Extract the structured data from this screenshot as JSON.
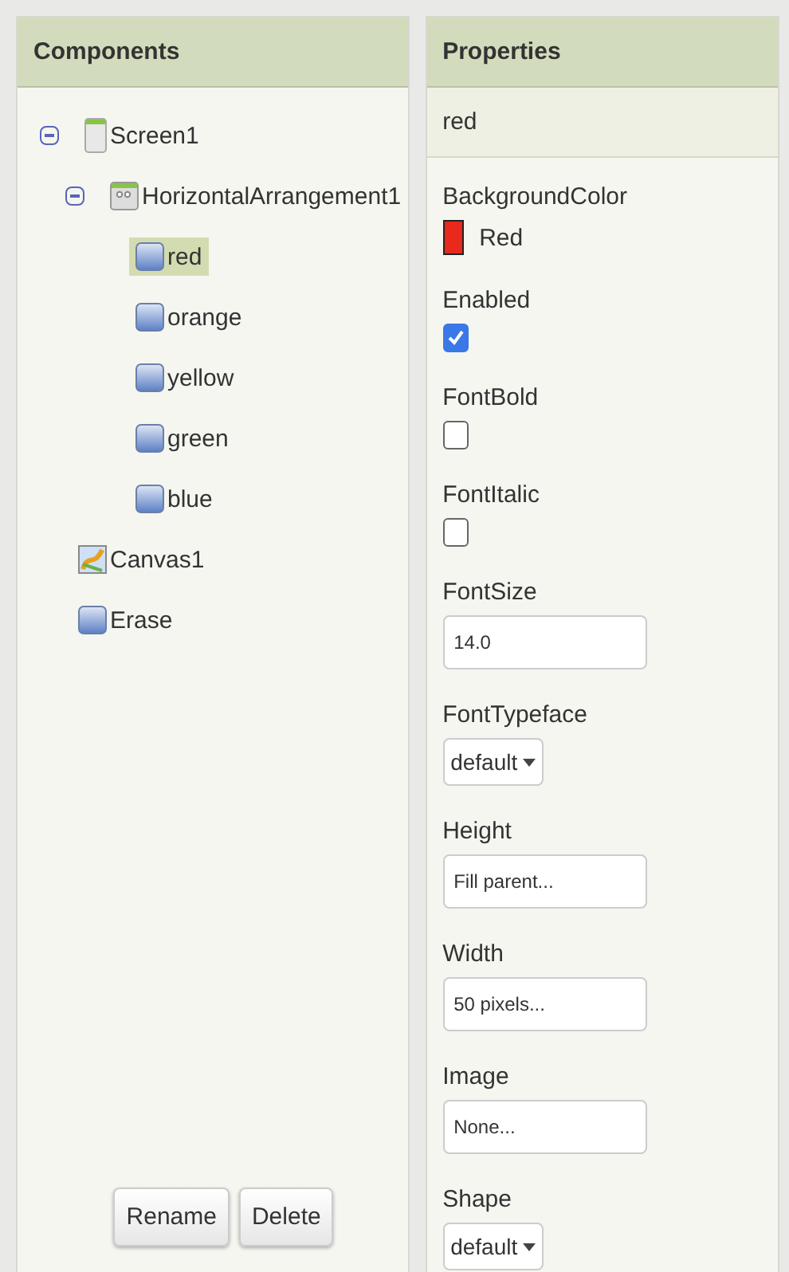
{
  "components": {
    "title": "Components",
    "tree": [
      {
        "label": "Screen1",
        "kind": "screen",
        "expanded": true,
        "selected": false,
        "children": [
          {
            "label": "HorizontalArrangement1",
            "kind": "arrangement",
            "expanded": true,
            "selected": false,
            "children": [
              {
                "label": "red",
                "kind": "button",
                "selected": true
              },
              {
                "label": "orange",
                "kind": "button",
                "selected": false
              },
              {
                "label": "yellow",
                "kind": "button",
                "selected": false
              },
              {
                "label": "green",
                "kind": "button",
                "selected": false
              },
              {
                "label": "blue",
                "kind": "button",
                "selected": false
              }
            ]
          },
          {
            "label": "Canvas1",
            "kind": "canvas",
            "selected": false
          },
          {
            "label": "Erase",
            "kind": "button",
            "selected": false
          }
        ]
      }
    ],
    "buttons": [
      "Rename",
      "Delete"
    ]
  },
  "properties": {
    "title": "Properties",
    "component": "red",
    "items": [
      {
        "label": "BackgroundColor",
        "kind": "color",
        "value": "Red",
        "color": "#e8291c"
      },
      {
        "label": "Enabled",
        "kind": "checkbox",
        "checked": true
      },
      {
        "label": "FontBold",
        "kind": "checkbox",
        "checked": false
      },
      {
        "label": "FontItalic",
        "kind": "checkbox",
        "checked": false
      },
      {
        "label": "FontSize",
        "kind": "text",
        "value": "14.0"
      },
      {
        "label": "FontTypeface",
        "kind": "dropdown",
        "value": "default"
      },
      {
        "label": "Height",
        "kind": "text",
        "value": "Fill parent..."
      },
      {
        "label": "Width",
        "kind": "text",
        "value": "50 pixels..."
      },
      {
        "label": "Image",
        "kind": "text",
        "value": "None..."
      },
      {
        "label": "Shape",
        "kind": "dropdown",
        "value": "default"
      }
    ]
  }
}
